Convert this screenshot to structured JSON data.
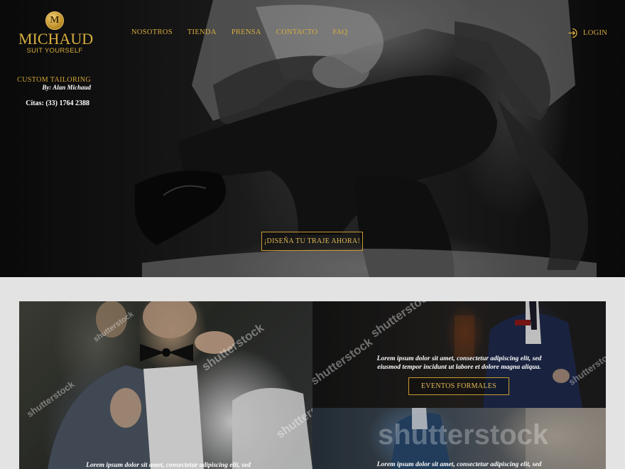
{
  "brand": {
    "medal_letter": "M",
    "name": "MICHAUD",
    "tagline": "SUIT YOURSELF",
    "gold": "#d8ad3f"
  },
  "intro": {
    "title": "CUSTOM TAILORING",
    "by": "By: Alan Michaud",
    "phone": "Citas: (33) 1764 2388"
  },
  "nav": {
    "items": [
      {
        "label": "NOSOTROS"
      },
      {
        "label": "TIENDA"
      },
      {
        "label": "PRENSA"
      },
      {
        "label": "CONTACTO"
      },
      {
        "label": "FAQ"
      }
    ],
    "login_label": "LOGIN",
    "login_icon": "login-icon"
  },
  "hero": {
    "cta_label": "¡DISEÑA TU TRAJE AHORA!"
  },
  "cards": {
    "big": {
      "text": "Lorem ipsum dolor sit amet, consectetur adipiscing elit, sed"
    },
    "top_right": {
      "text_line1": "Lorem ipsum dolor sit amet, consectetur adipiscing elit, sed",
      "text_line2": "eiusmod tempor incidunt ut labore et dolore magna aliqua.",
      "button_label": "EVENTOS FORMALES"
    },
    "bottom_right": {
      "text": "Lorem ipsum dolor sit amet, consectetur adipiscing elit, sed"
    },
    "watermark": "shutterstock"
  }
}
